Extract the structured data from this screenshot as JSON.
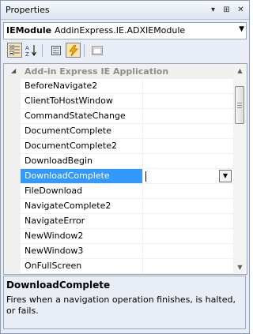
{
  "window": {
    "title": "Properties",
    "buttons": [
      "▾",
      "⊞",
      "✕"
    ]
  },
  "object_selector": {
    "type_name": "IEModule",
    "full_name": "AddinExpress.IE.ADXIEModule"
  },
  "toolbar": {
    "tools": [
      {
        "name": "categorized-icon",
        "pressed": true
      },
      {
        "name": "alphabetical-icon",
        "pressed": false
      },
      {
        "name": "properties-icon",
        "pressed": false
      },
      {
        "name": "events-icon",
        "pressed": true
      },
      {
        "name": "property-pages-icon",
        "pressed": false
      }
    ]
  },
  "grid": {
    "category": {
      "toggle": "◢",
      "label": "Add-in Express IE Application"
    },
    "properties": [
      "BeforeNavigate2",
      "ClientToHostWindow",
      "CommandStateChange",
      "DocumentComplete",
      "DocumentComplete2",
      "DownloadBegin",
      "DownloadComplete",
      "FileDownload",
      "NavigateComplete2",
      "NavigateError",
      "NewWindow2",
      "NewWindow3",
      "OnFullScreen"
    ],
    "selected_index": 6,
    "dropdown_glyph": "▼",
    "scroll_up_glyph": "▲",
    "scroll_down_glyph": "▼"
  },
  "description": {
    "title": "DownloadComplete",
    "text": "Fires when a navigation operation finishes, is halted, or fails."
  }
}
